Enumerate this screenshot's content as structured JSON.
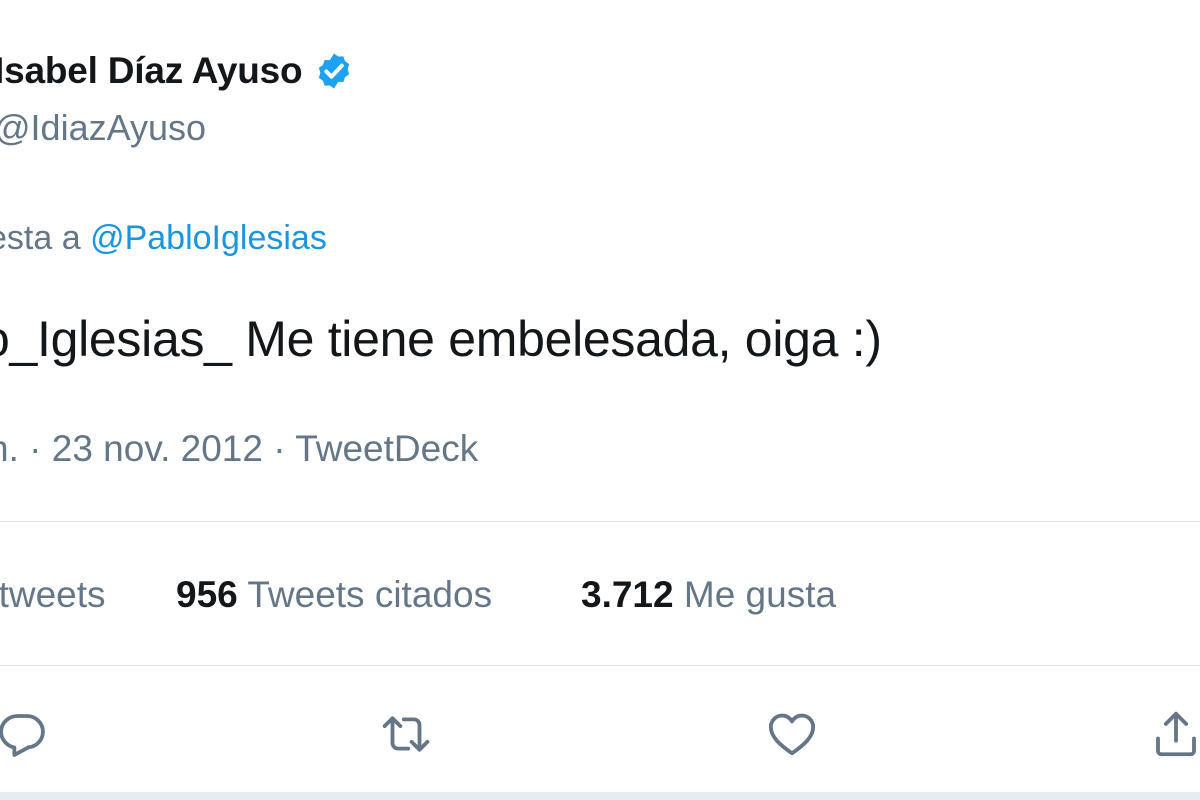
{
  "author": {
    "display_name": "Isabel Díaz Ayuso",
    "verified_icon": "verified-badge-icon",
    "handle": "@IdiazAyuso"
  },
  "reply": {
    "prefix": "esta a ",
    "mention": "@PabloIglesias"
  },
  "tweet": {
    "text": "o_Iglesias_ Me tiene embelesada, oiga :)"
  },
  "meta": {
    "time_fragment": "n. · ",
    "date": "23 nov. 2012",
    "separator": " · ",
    "source": "TweetDeck"
  },
  "stats": {
    "retweets_label": "etweets",
    "quotes_count": "956",
    "quotes_label": " Tweets citados",
    "likes_count": "3.712",
    "likes_label": " Me gusta"
  },
  "actions": {
    "reply_icon": "reply-icon",
    "retweet_icon": "retweet-icon",
    "like_icon": "heart-icon",
    "share_icon": "share-icon"
  },
  "colors": {
    "accent": "#1b95e0",
    "verified": "#1da1f2",
    "text_primary": "#14171a",
    "text_secondary": "#657786",
    "divider": "#e1e8ed"
  }
}
